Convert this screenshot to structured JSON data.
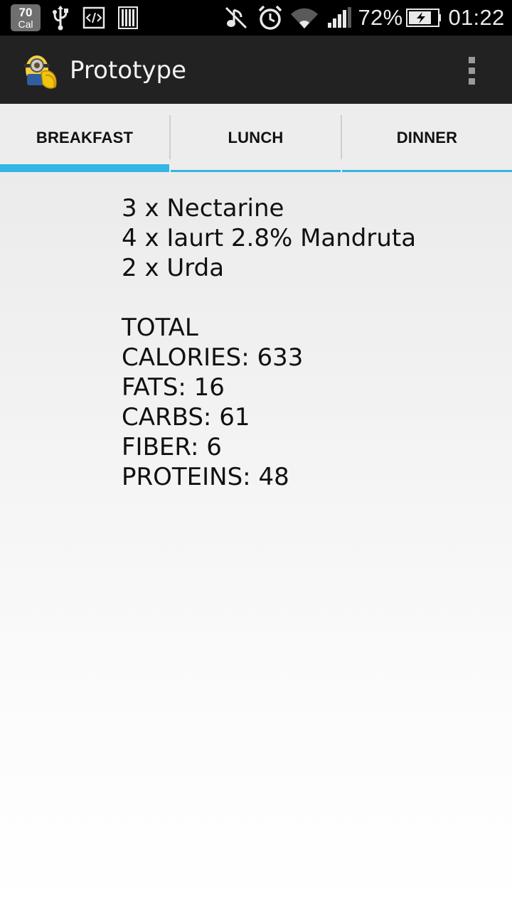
{
  "status_bar": {
    "calorie_badge": {
      "value": "70",
      "unit": "Cal"
    },
    "icons": [
      "usb-icon",
      "developer-icon",
      "barcode-icon",
      "music-muted-icon",
      "alarm-icon",
      "wifi-icon",
      "signal-icon",
      "battery-charging-icon"
    ],
    "battery_percent": "72%",
    "time": "01:22"
  },
  "action_bar": {
    "app_icon": "minion-app-icon",
    "title": "Prototype",
    "overflow_icon": "overflow-menu-icon"
  },
  "tabs": [
    {
      "label": "BREAKFAST",
      "selected": true
    },
    {
      "label": "LUNCH",
      "selected": false
    },
    {
      "label": "DINNER",
      "selected": false
    }
  ],
  "accent_color": "#33b5e5",
  "meal": {
    "items": [
      "3 x Nectarine",
      "4 x Iaurt 2.8% Mandruta",
      "2 x Urda"
    ],
    "total_heading": "TOTAL",
    "calories": "CALORIES: 633",
    "fats": "FATS: 16",
    "carbs": "CARBS: 61",
    "fiber": "FIBER: 6",
    "proteins": "PROTEINS: 48"
  }
}
